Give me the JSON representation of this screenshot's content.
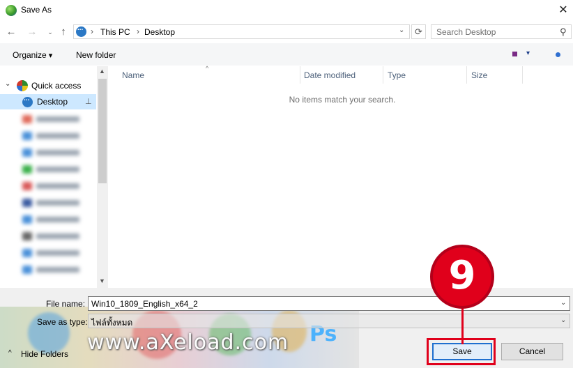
{
  "window": {
    "title": "Save As",
    "close_glyph": "✕"
  },
  "nav": {
    "back_glyph": "←",
    "forward_glyph": "→",
    "recent_glyph": "⌄",
    "up_glyph": "↑",
    "breadcrumb": [
      "This PC",
      "Desktop"
    ],
    "separator": "›",
    "address_dropdown_glyph": "⌄",
    "refresh_glyph": "⟳",
    "search_placeholder": "Search Desktop",
    "search_icon_glyph": "⚲"
  },
  "toolbar": {
    "organize_label": "Organize",
    "new_folder_label": "New folder",
    "view_dropdown_glyph": "▾"
  },
  "sidebar": {
    "chevron_glyph": "⌄",
    "quick_access_label": "Quick access",
    "desktop_label": "Desktop",
    "pin_glyph": "📌",
    "blurred_items": [
      {
        "color": "#e06a5a"
      },
      {
        "color": "#4a90d9"
      },
      {
        "color": "#4a90d9"
      },
      {
        "color": "#3ab04a"
      },
      {
        "color": "#d95a5a"
      },
      {
        "color": "#3a5aa0"
      },
      {
        "color": "#4a90d9"
      },
      {
        "color": "#666666"
      },
      {
        "color": "#4a90d9"
      },
      {
        "color": "#4a90d9"
      }
    ],
    "scroll_up_glyph": "▲",
    "scroll_down_glyph": "▼"
  },
  "file_list": {
    "columns": [
      "Name",
      "Date modified",
      "Type",
      "Size"
    ],
    "sort_glyph": "^",
    "empty_message": "No items match your search."
  },
  "form": {
    "file_name_label": "File name:",
    "file_name_value": "Win10_1809_English_x64_2",
    "save_type_label": "Save as type:",
    "save_type_value": "ไฟล์ทั้งหมด",
    "dropdown_glyph": "⌄"
  },
  "footer": {
    "hide_folders_glyph": "^",
    "hide_folders_label": "Hide Folders",
    "save_label": "Save",
    "cancel_label": "Cancel"
  },
  "watermark": {
    "text": "www.aXeload.com",
    "ps_text": "Ps"
  },
  "annotation": {
    "step_number": "9",
    "color": "#e0001b"
  }
}
